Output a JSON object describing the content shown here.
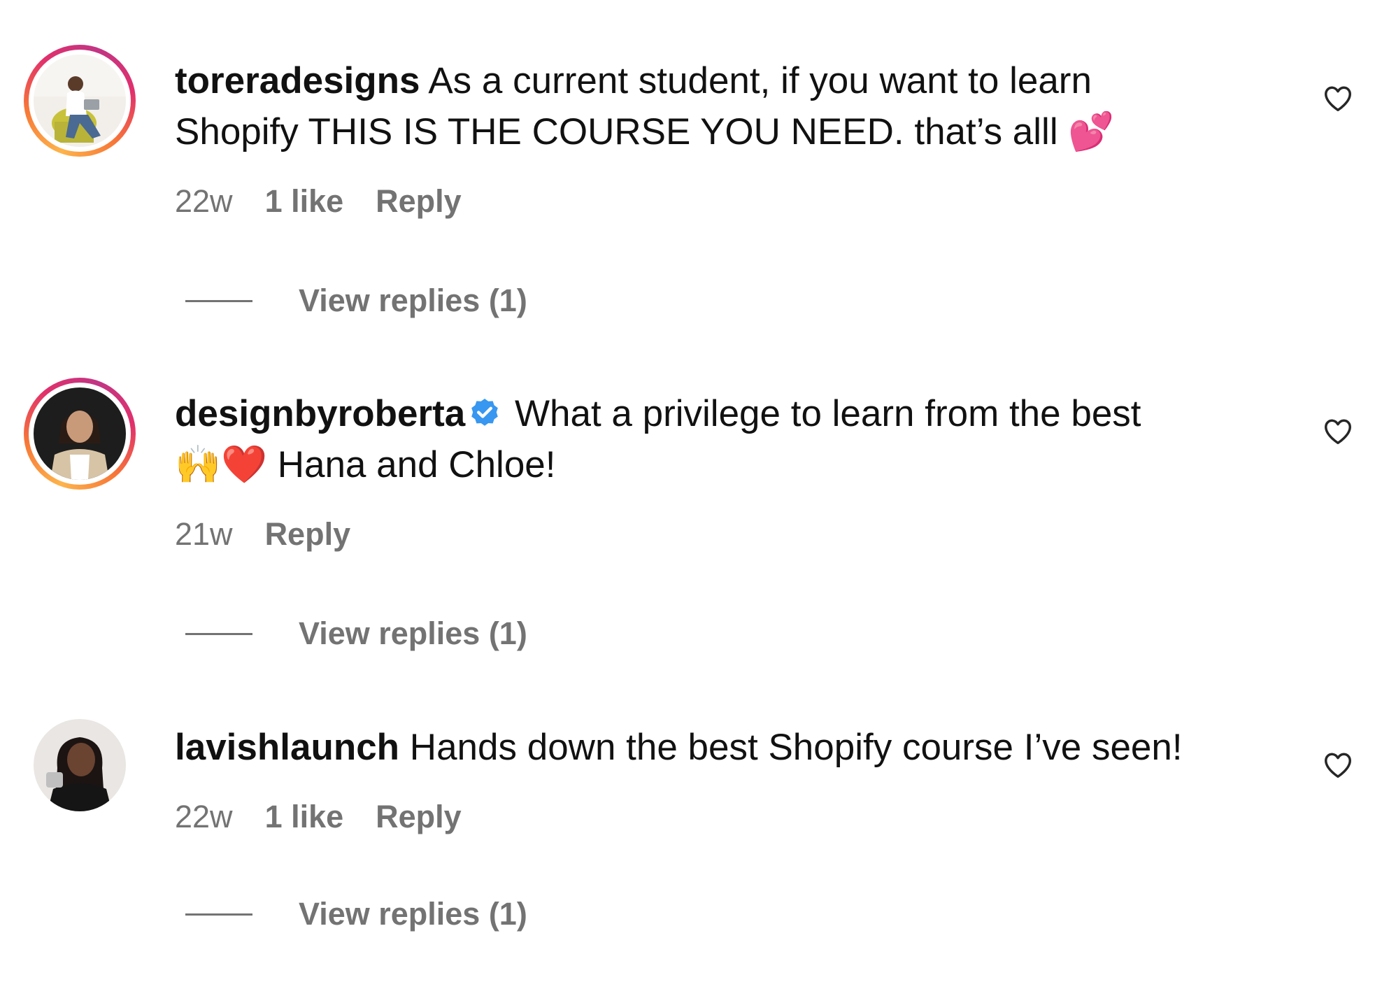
{
  "comments": [
    {
      "username": "toreradesigns",
      "verified": false,
      "text_line1": " As a current student, if you want to learn",
      "text_line2": "Shopify THIS IS THE COURSE YOU NEED. that’s alll ",
      "emoji_end": "💕",
      "time": "22w",
      "likes": "1 like",
      "reply_label": "Reply",
      "view_replies": "View replies (1)",
      "story_ring": true
    },
    {
      "username": "designbyroberta",
      "verified": true,
      "text_line1": " What a privilege to learn from the best",
      "emoji_start": "🙌❤️",
      "text_line2": " Hana and Chloe!",
      "time": "21w",
      "reply_label": "Reply",
      "view_replies": "View replies (1)",
      "story_ring": true
    },
    {
      "username": "lavishlaunch",
      "verified": false,
      "text_line1": " Hands down the best Shopify course I’ve seen!",
      "time": "22w",
      "likes": "1 like",
      "reply_label": "Reply",
      "view_replies": "View replies (1)",
      "story_ring": false
    }
  ],
  "icons": {
    "like": "heart-outline-icon",
    "verified": "verified-badge-icon"
  },
  "colors": {
    "meta_text": "#737373",
    "verified_blue": "#3897f0",
    "story_ring_start": "#fdb44b",
    "story_ring_end": "#c13584"
  }
}
